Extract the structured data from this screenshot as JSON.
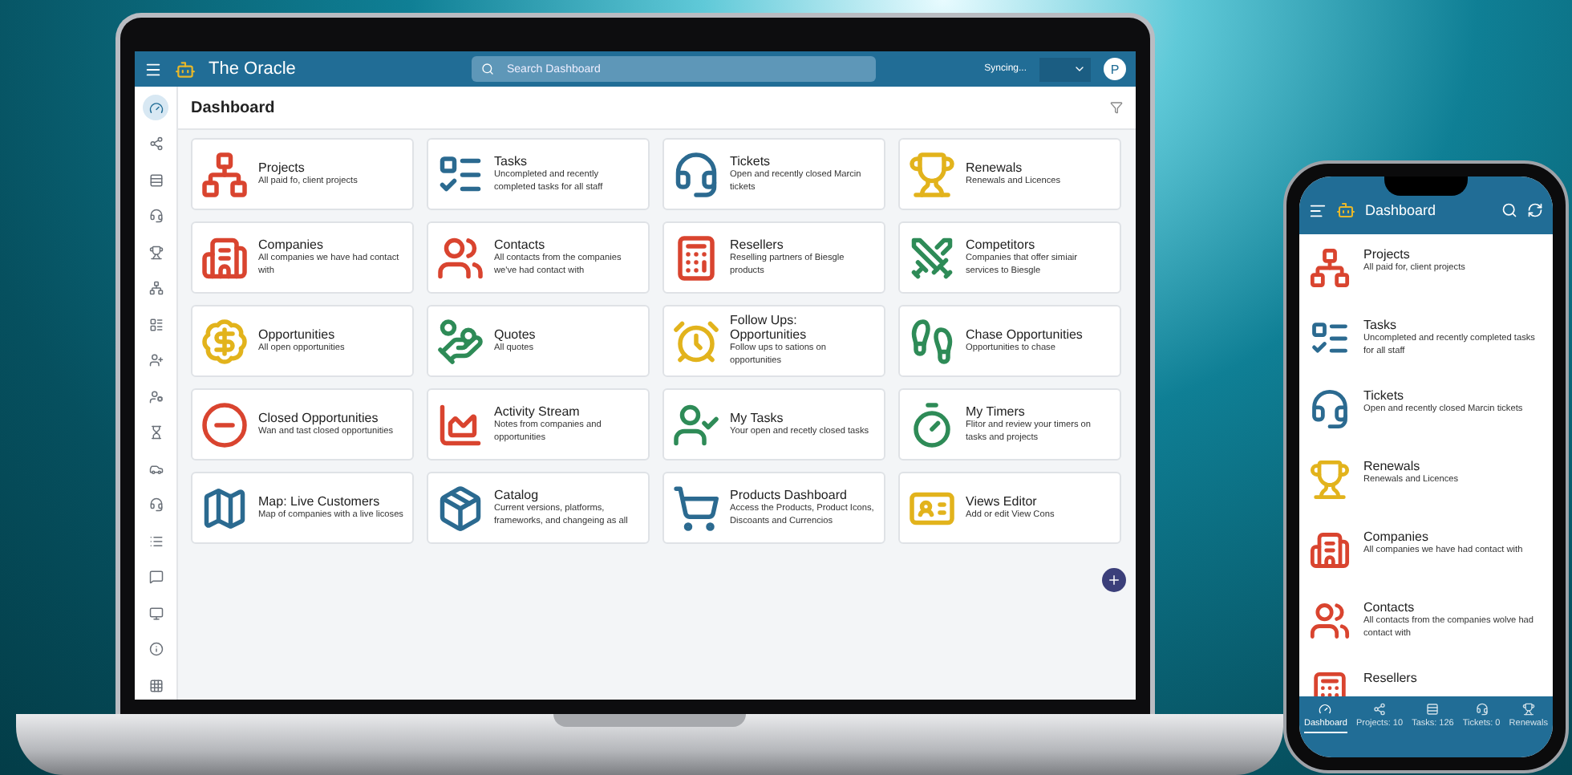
{
  "app": {
    "title": "The Oracle",
    "search": {
      "placeholder": "Search Dashboard"
    },
    "sync_status": "Syncing...",
    "avatar": "P"
  },
  "sidebar": {
    "items": [
      {
        "selected": true
      },
      {
        "selected": false
      },
      {
        "selected": false
      },
      {
        "selected": false
      },
      {
        "selected": false
      },
      {
        "selected": false
      },
      {
        "selected": false
      },
      {
        "selected": false
      },
      {
        "selected": false
      },
      {
        "selected": false
      },
      {
        "selected": false
      },
      {
        "selected": false
      },
      {
        "selected": false
      },
      {
        "selected": false
      },
      {
        "selected": false
      },
      {
        "selected": false
      },
      {
        "selected": false
      }
    ]
  },
  "page_title": "Dashboard",
  "tiles": [
    {
      "title": "Projects",
      "description": "All paid fo, client projects"
    },
    {
      "title": "Tasks",
      "description": "Uncompleted and recently completed tasks for all staff"
    },
    {
      "title": "Tickets",
      "description": "Open and recently closed Marcin tickets"
    },
    {
      "title": "Renewals",
      "description": "Renewals and Licences"
    },
    {
      "title": "Companies",
      "description": "All companies we have had contact with"
    },
    {
      "title": "Contacts",
      "description": "All contacts from the companies we've had contact with"
    },
    {
      "title": "Resellers",
      "description": "Reselling partners of Biesgle products"
    },
    {
      "title": "Competitors",
      "description": "Companies that offer simiair services to Biesgle"
    },
    {
      "title": "Opportunities",
      "description": "All open opportunities"
    },
    {
      "title": "Quotes",
      "description": "All quotes"
    },
    {
      "title": "Follow Ups: Opportunities",
      "description": "Follow ups to sations on opportunities"
    },
    {
      "title": "Chase Opportunities",
      "description": "Opportunities to chase"
    },
    {
      "title": "Closed Opportunities",
      "description": "Wan and tast closed opportunities"
    },
    {
      "title": "Activity Stream",
      "description": "Notes from companies and opportunities"
    },
    {
      "title": "My Tasks",
      "description": "Your open and recetly closed tasks"
    },
    {
      "title": "My Timers",
      "description": "Flitor and review your timers on tasks and projects"
    },
    {
      "title": "Map: Live Customers",
      "description": "Map of companies with a live licoses"
    },
    {
      "title": "Catalog",
      "description": "Current versions, platforms, frameworks, and changeing as all"
    },
    {
      "title": "Products Dashboard",
      "description": "Access the Products, Product Icons, Discoants and Currencios"
    },
    {
      "title": "Views Editor",
      "description": "Add or edit View Cons"
    }
  ],
  "phone": {
    "title": "Dashboard",
    "items": [
      {
        "title": "Projects",
        "description": "All paid for, client projects"
      },
      {
        "title": "Tasks",
        "description": "Uncompleted and recently completed tasks for all staff"
      },
      {
        "title": "Tickets",
        "description": "Open and recently closed Marcin tickets"
      },
      {
        "title": "Renewals",
        "description": "Renewals and Licences"
      },
      {
        "title": "Companies",
        "description": "All companies we have had contact with"
      },
      {
        "title": "Contacts",
        "description": "All contacts from the companies wolve had contact with"
      },
      {
        "title": "Resellers"
      }
    ],
    "nav": [
      {
        "label": "Dashboard",
        "selected": true
      },
      {
        "label": "Projects: 10",
        "selected": false
      },
      {
        "label": "Tasks: 126",
        "selected": false
      },
      {
        "label": "Tickets: 0",
        "selected": false
      },
      {
        "label": "Renewals",
        "selected": false
      }
    ]
  }
}
